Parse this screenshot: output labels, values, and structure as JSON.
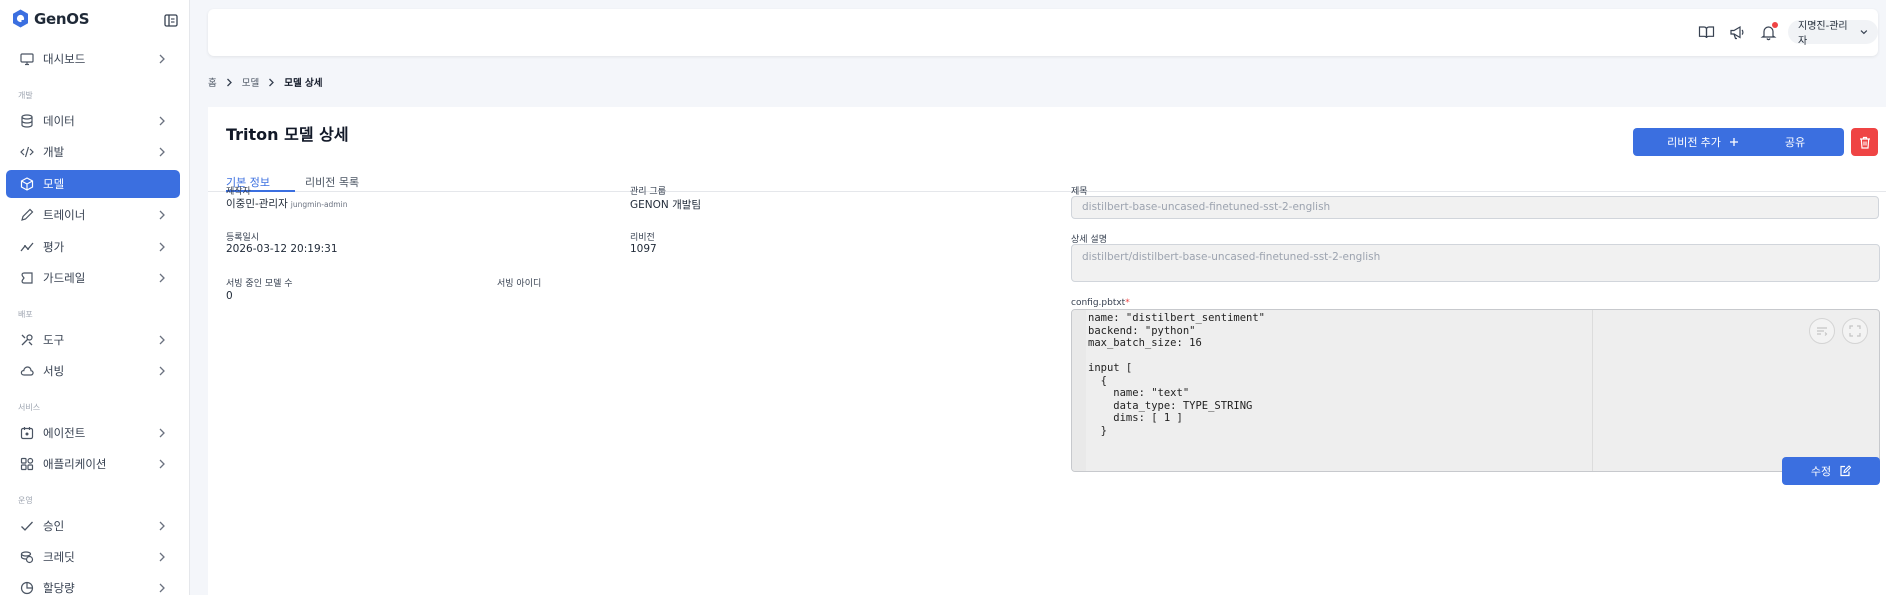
{
  "brand": {
    "name": "GenOS",
    "color": "#3b6fe0"
  },
  "sidebar": {
    "items": [
      {
        "label": "대시보드",
        "icon": "monitor-icon"
      },
      {
        "label": "데이터",
        "icon": "database-icon"
      },
      {
        "label": "개발",
        "icon": "code-icon"
      },
      {
        "label": "모델",
        "icon": "cube-icon"
      },
      {
        "label": "트레이너",
        "icon": "pencil-icon"
      },
      {
        "label": "평가",
        "icon": "trend-line-icon"
      },
      {
        "label": "가드레일",
        "icon": "guardrail-icon"
      },
      {
        "label": "도구",
        "icon": "tools-icon"
      },
      {
        "label": "서빙",
        "icon": "cloud-icon"
      },
      {
        "label": "에이전트",
        "icon": "calendar-agent-icon"
      },
      {
        "label": "애플리케이션",
        "icon": "apps-grid-icon"
      },
      {
        "label": "승인",
        "icon": "check-icon"
      },
      {
        "label": "크레딧",
        "icon": "coins-icon"
      },
      {
        "label": "할당량",
        "icon": "pie-chart-icon"
      }
    ],
    "sections": [
      "개발",
      "배포",
      "서비스",
      "운영"
    ]
  },
  "header": {
    "icons": [
      "book-icon",
      "megaphone-icon",
      "bell-icon"
    ],
    "user": "지명진-관리자"
  },
  "breadcrumb": {
    "home": "홈",
    "parent": "모델",
    "current": "모델 상세"
  },
  "page": {
    "title": "Triton 모델 상세",
    "tabs": [
      "기본 정보",
      "리비전 목록"
    ],
    "buttons": {
      "add_revision": "리비전 추가",
      "share": "공유",
      "edit": "수정"
    }
  },
  "info": {
    "creator_label": "제작자",
    "creator": "이중민-관리자",
    "creator_id": "jungmin-admin",
    "group_label": "관리 그룹",
    "group": "GENON 개발팀",
    "registered_label": "등록일시",
    "registered": "2026-03-12 20:19:31",
    "revision_label": "리비전",
    "revision": "1097",
    "serving_count_label": "서빙 중인 모델 수",
    "serving_count": "0",
    "serving_id_label": "서빙 아이디"
  },
  "form": {
    "title_label": "제목",
    "title_value": "distilbert-base-uncased-finetuned-sst-2-english",
    "desc_label": "상세 설명",
    "desc_value": "distilbert/distilbert-base-uncased-finetuned-sst-2-english",
    "config_label": "config.pbtxt",
    "required_mark": "*",
    "config_lines": [
      "name: \"distilbert_sentiment\"",
      "backend: \"python\"",
      "max_batch_size: 16",
      "",
      "input [",
      "  {",
      "    name: \"text\"",
      "    data_type: TYPE_STRING",
      "    dims: [ 1 ]",
      "  }"
    ]
  }
}
